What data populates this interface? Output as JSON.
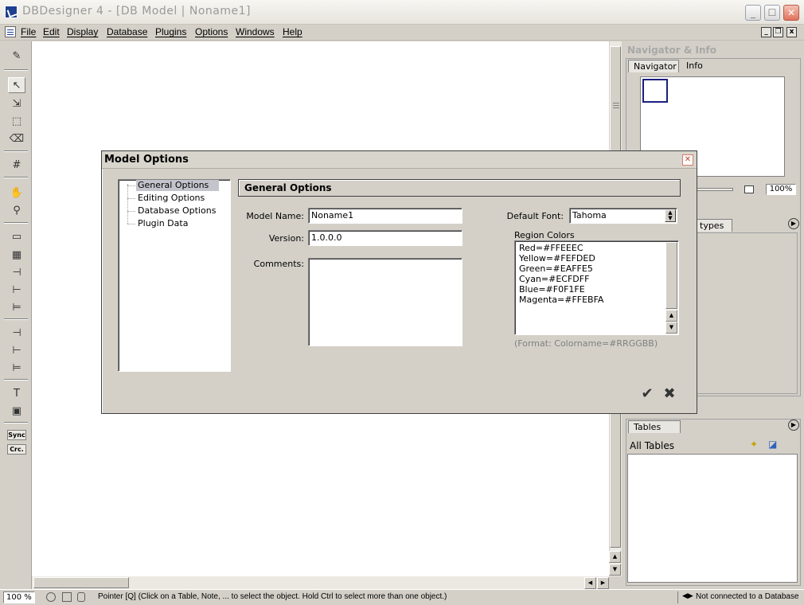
{
  "window": {
    "title": "DBDesigner 4 - [DB Model | Noname1]"
  },
  "menu": [
    "File",
    "Edit",
    "Display",
    "Database",
    "Plugins",
    "Options",
    "Windows",
    "Help"
  ],
  "mdi_buttons": [
    "_",
    "❐",
    "x"
  ],
  "toolbar": {
    "sync": "Sync",
    "crc": "Crc."
  },
  "navigator": {
    "title": "Navigator & Info",
    "tabs": [
      "Navigator",
      "Info"
    ],
    "zoom": "100%"
  },
  "datatypes": {
    "tab": "types"
  },
  "tables_panel": {
    "tab": "Tables",
    "header": "All Tables"
  },
  "status": {
    "zoom": "100 %",
    "message": "Pointer [Q] (Click on a Table, Note, ... to select the object. Hold Ctrl to select more than one object.)",
    "connection": "Not connected to a Database"
  },
  "dialog": {
    "title": "Model Options",
    "tree": [
      "General Options",
      "Editing Options",
      "Database Options",
      "Plugin Data"
    ],
    "selected_tree_index": 0,
    "section_header": "General Options",
    "model_name_label": "Model Name:",
    "model_name_value": "Noname1",
    "version_label": "Version:",
    "version_value": "1.0.0.0",
    "comments_label": "Comments:",
    "comments_value": "",
    "default_font_label": "Default Font:",
    "default_font_value": "Tahoma",
    "region_colors_label": "Region Colors",
    "region_colors": [
      "Red=#FFEEEC",
      "Yellow=#FEFDED",
      "Green=#EAFFE5",
      "Cyan=#ECFDFF",
      "Blue=#F0F1FE",
      "Magenta=#FFEBFA"
    ],
    "format_hint": "(Format: Colorname=#RRGGBB)",
    "ok_label": "✔",
    "cancel_label": "✖"
  }
}
